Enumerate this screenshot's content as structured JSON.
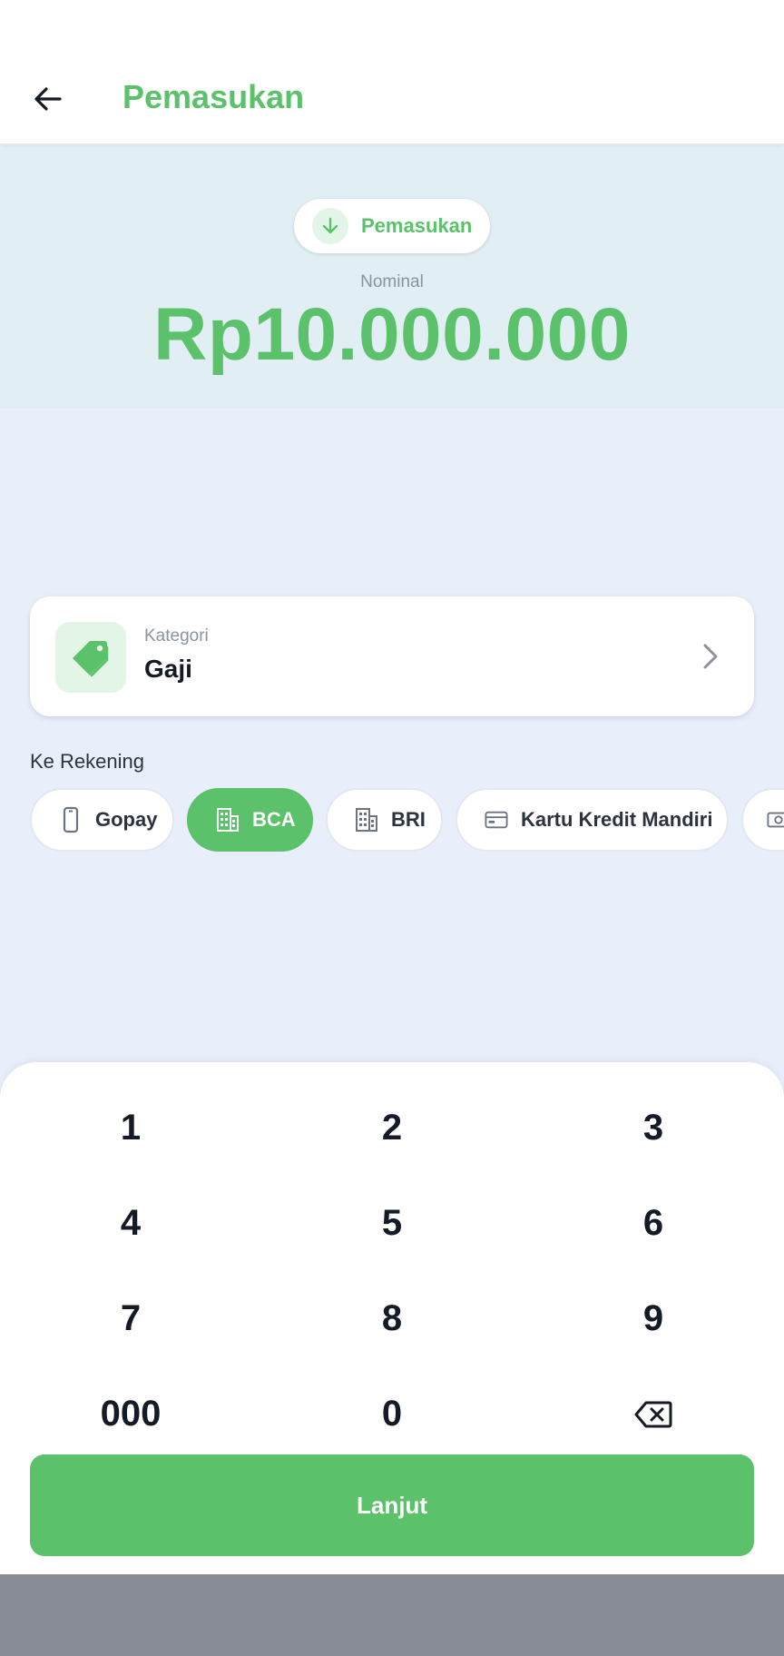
{
  "header": {
    "title": "Pemasukan",
    "back_icon": "arrow-left-icon"
  },
  "hero": {
    "type_label": "Pemasukan",
    "type_icon": "arrow-down-icon",
    "nominal_label": "Nominal",
    "amount": "Rp10.000.000"
  },
  "category": {
    "label": "Kategori",
    "value": "Gaji",
    "icon": "tag-icon"
  },
  "accounts": {
    "title": "Ke Rekening",
    "selected": "BCA",
    "items": [
      {
        "label": "Gopay",
        "icon": "phone-icon"
      },
      {
        "label": "BCA",
        "icon": "building-icon"
      },
      {
        "label": "BRI",
        "icon": "building-icon"
      },
      {
        "label": "Kartu Kredit Mandiri",
        "icon": "credit-card-icon"
      },
      {
        "label": "",
        "icon": "cash-icon"
      }
    ]
  },
  "keypad": {
    "keys": [
      "1",
      "2",
      "3",
      "4",
      "5",
      "6",
      "7",
      "8",
      "9",
      "000",
      "0"
    ],
    "backspace_icon": "backspace-icon"
  },
  "submit_label": "Lanjut",
  "colors": {
    "accent": "#5bc16a",
    "hero_bg": "#e1eef3",
    "page_bg": "#e8eefa"
  }
}
